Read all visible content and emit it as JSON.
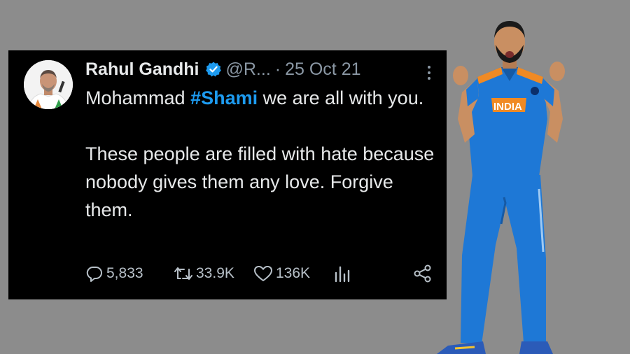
{
  "tweet": {
    "author_name": "Rahul Gandhi",
    "handle": "@R...",
    "separator": "·",
    "date": "25 Oct 21",
    "text_line1_prefix": "Mohammad ",
    "hashtag": "#Shami",
    "text_line1_suffix": " we are all with you.",
    "text_para2": "These people are filled with hate because nobody gives them any love. Forgive them.",
    "replies": "5,833",
    "retweets": "33.9K",
    "likes": "136K"
  },
  "player_jersey_text": "INDIA",
  "colors": {
    "background": "#8c8c8c",
    "card": "#000000",
    "text": "#e7e9ea",
    "muted": "#8b98a5",
    "hashtag": "#1d9bf0",
    "jersey": "#1e78d6"
  },
  "icons": [
    "verified-icon",
    "more-icon",
    "reply-icon",
    "retweet-icon",
    "like-icon",
    "views-icon",
    "share-icon"
  ]
}
